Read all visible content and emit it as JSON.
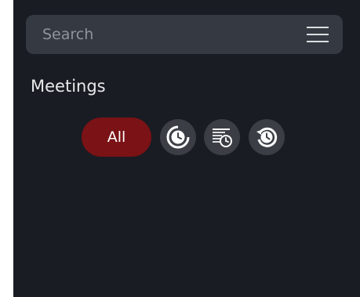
{
  "search": {
    "placeholder": "Search"
  },
  "header": {
    "menu_icon": "hamburger-menu-icon"
  },
  "meetings": {
    "title": "Meetings",
    "filters": [
      {
        "label": "All",
        "selected": true
      },
      {
        "icon": "clock-cycle-icon",
        "selected": false
      },
      {
        "icon": "calendar-clock-icon",
        "selected": false
      },
      {
        "icon": "history-clock-icon",
        "selected": false
      }
    ]
  },
  "colors": {
    "background": "#191c22",
    "search_bg": "#353a42",
    "accent_selected": "#7a1216",
    "icon_button_bg": "#3b3f45"
  }
}
